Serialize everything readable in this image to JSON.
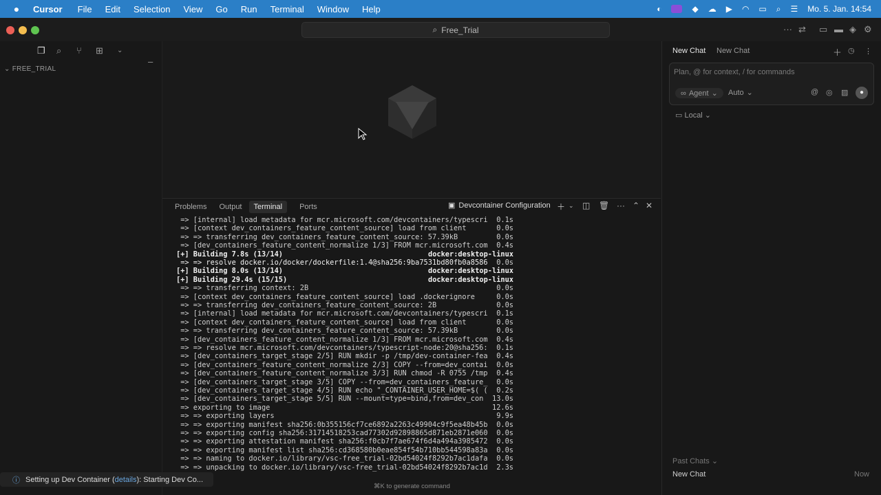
{
  "menubar": {
    "app": "Cursor",
    "items": [
      "File",
      "Edit",
      "Selection",
      "View",
      "Go",
      "Run",
      "Terminal",
      "Window",
      "Help"
    ],
    "datetime": "Mo. 5. Jan.  14:54"
  },
  "titlebar": {
    "search": "Free_Trial"
  },
  "sidebar": {
    "folder": "FREE_TRIAL"
  },
  "panel": {
    "tabs": [
      "Problems",
      "Output",
      "Terminal",
      "Ports"
    ],
    "active_tab": "Terminal",
    "terminal_name": "Devcontainer Configuration"
  },
  "terminal_lines": [
    {
      "text": " => [internal] load metadata for mcr.microsoft.com/devcontainers/typescri",
      "dur": "0.1s"
    },
    {
      "text": " => [context dev_containers_feature_content_source] load from client",
      "dur": "0.0s"
    },
    {
      "text": " => => transferring dev_containers_feature_content_source: 57.39kB",
      "dur": "0.0s"
    },
    {
      "text": " => [dev_containers_feature_content_normalize 1/3] FROM mcr.microsoft.com",
      "dur": "0.4s"
    },
    {
      "text": "[+] Building 7.8s (13/14)",
      "dur": "docker:desktop-linux",
      "bold": true
    },
    {
      "text": " => => resolve docker.io/docker/dockerfile:1.4@sha256:9ba7531bd80fb0a8586",
      "dur": "0.0s",
      "mid": true
    },
    {
      "text": "[+] Building 8.0s (13/14)",
      "dur": "docker:desktop-linux",
      "bold": true
    },
    {
      "text": "[+] Building 29.4s (15/15)",
      "dur": "docker:desktop-linux",
      "bold": true
    },
    {
      "text": " => => transferring context: 2B",
      "dur": "0.0s"
    },
    {
      "text": " => [context dev_containers_feature_content_source] load .dockerignore",
      "dur": "0.0s"
    },
    {
      "text": " => => transferring dev_containers_feature_content_source: 2B",
      "dur": "0.0s"
    },
    {
      "text": " => [internal] load metadata for mcr.microsoft.com/devcontainers/typescri",
      "dur": "0.1s"
    },
    {
      "text": " => [context dev_containers_feature_content_source] load from client",
      "dur": "0.0s"
    },
    {
      "text": " => => transferring dev_containers_feature_content_source: 57.39kB",
      "dur": "0.0s"
    },
    {
      "text": " => [dev_containers_feature_content_normalize 1/3] FROM mcr.microsoft.com",
      "dur": "0.4s"
    },
    {
      "text": " => => resolve mcr.microsoft.com/devcontainers/typescript-node:20@sha256:",
      "dur": "0.1s"
    },
    {
      "text": " => [dev_containers_target_stage 2/5] RUN mkdir -p /tmp/dev-container-fea",
      "dur": "0.4s"
    },
    {
      "text": " => [dev_containers_feature_content_normalize 2/3] COPY --from=dev_contai",
      "dur": "0.0s"
    },
    {
      "text": " => [dev_containers_feature_content_normalize 3/3] RUN chmod -R 0755 /tmp",
      "dur": "0.4s"
    },
    {
      "text": " => [dev_containers_target_stage 3/5] COPY --from=dev_containers_feature_",
      "dur": "0.0s"
    },
    {
      "text": " => [dev_containers_target_stage 4/5] RUN echo \"_CONTAINER_USER_HOME=$( (",
      "dur": "0.2s"
    },
    {
      "text": " => [dev_containers_target_stage 5/5] RUN --mount=type=bind,from=dev_con",
      "dur": "13.0s"
    },
    {
      "text": " => exporting to image",
      "dur": "12.6s"
    },
    {
      "text": " => => exporting layers",
      "dur": "9.9s"
    },
    {
      "text": " => => exporting manifest sha256:0b355156cf7ce6892a2263c49904c9f5ea48b45b",
      "dur": "0.0s"
    },
    {
      "text": " => => exporting config sha256:31714518253cad77302d92898865d871eb2871e060",
      "dur": "0.0s"
    },
    {
      "text": " => => exporting attestation manifest sha256:f0cb7f7ae674f6d4a494a3985472",
      "dur": "0.0s"
    },
    {
      "text": " => => exporting manifest list sha256:cd368580b0eae854f54b710bb544598a83a",
      "dur": "0.0s"
    },
    {
      "text": " => => naming to docker.io/library/vsc-free_trial-02bd54024f8292b7ac1dafa",
      "dur": "0.0s"
    },
    {
      "text": " => => unpacking to docker.io/library/vsc-free_trial-02bd54024f8292b7ac1d",
      "dur": "2.3s"
    }
  ],
  "terminal_hint": "⌘K to generate command",
  "status": {
    "prefix": "Setting up Dev Container (",
    "link": "details",
    "suffix": "): Starting Dev Co..."
  },
  "chat": {
    "tab_active": "New Chat",
    "tab_other": "New Chat",
    "placeholder": "Plan, @ for context, / for commands",
    "mode": "Agent",
    "model": "Auto",
    "location": "Local",
    "past_chats": "Past Chats",
    "history_item": "New Chat",
    "history_time": "Now"
  },
  "colors": {
    "menubar": "#2b7fc7",
    "background": "#181818"
  }
}
